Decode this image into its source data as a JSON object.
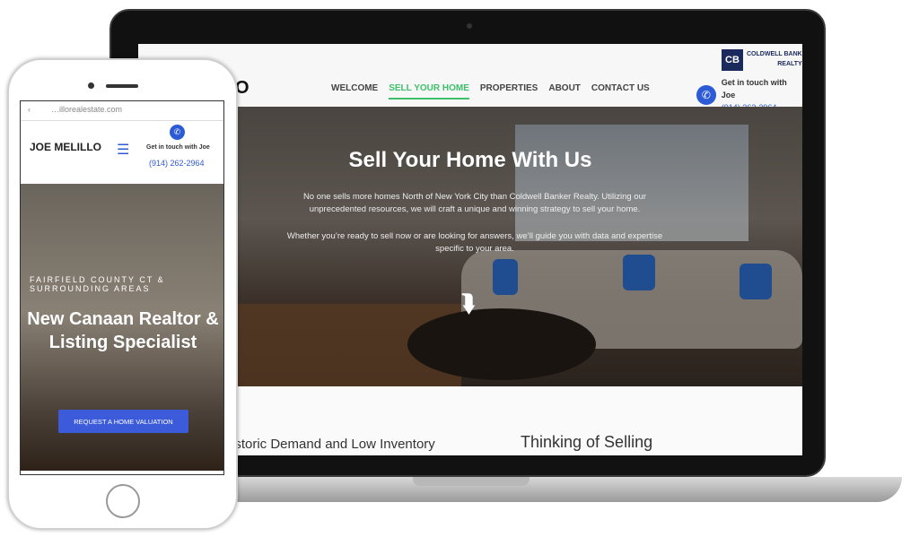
{
  "laptop": {
    "logo_fragment": "O",
    "nav": [
      {
        "label": "WELCOME"
      },
      {
        "label": "SELL YOUR HOME",
        "active": true
      },
      {
        "label": "PROPERTIES"
      },
      {
        "label": "ABOUT"
      },
      {
        "label": "CONTACT US"
      }
    ],
    "brand": {
      "mark": "CB",
      "name": "COLDWELL BANK",
      "sub": "REALTY"
    },
    "contact": {
      "label": "Get in touch with Joe",
      "phone": "(914) 262-2964"
    },
    "hero": {
      "title": "Sell Your Home With Us",
      "para1": "No one sells more homes North of New York City than Coldwell Banker Realty. Utilizing our unprecedented resources, we will craft a unique and winning strategy to sell your home.",
      "para2": "Whether you’re ready to sell now or are looking for answers, we’ll guide you with data and expertise specific to your area."
    },
    "sections": [
      "istoric Demand and Low Inventory",
      "Thinking of Selling"
    ]
  },
  "phone": {
    "url": "…illorealestate.com",
    "name": "JOE MELILLO",
    "contact": {
      "label": "Get in touch with Joe",
      "phone": "(914) 262-2964"
    },
    "hero": {
      "subtitle": "FAIRFIELD COUNTY CT & SURROUNDING AREAS",
      "title": "New Canaan Realtor & Listing Specialist",
      "button": "REQUEST A HOME VALUATION"
    }
  },
  "colors": {
    "accent_green": "#3fbf6a",
    "brand_blue": "#2d5bd6",
    "button_blue": "#3b5bdb"
  }
}
